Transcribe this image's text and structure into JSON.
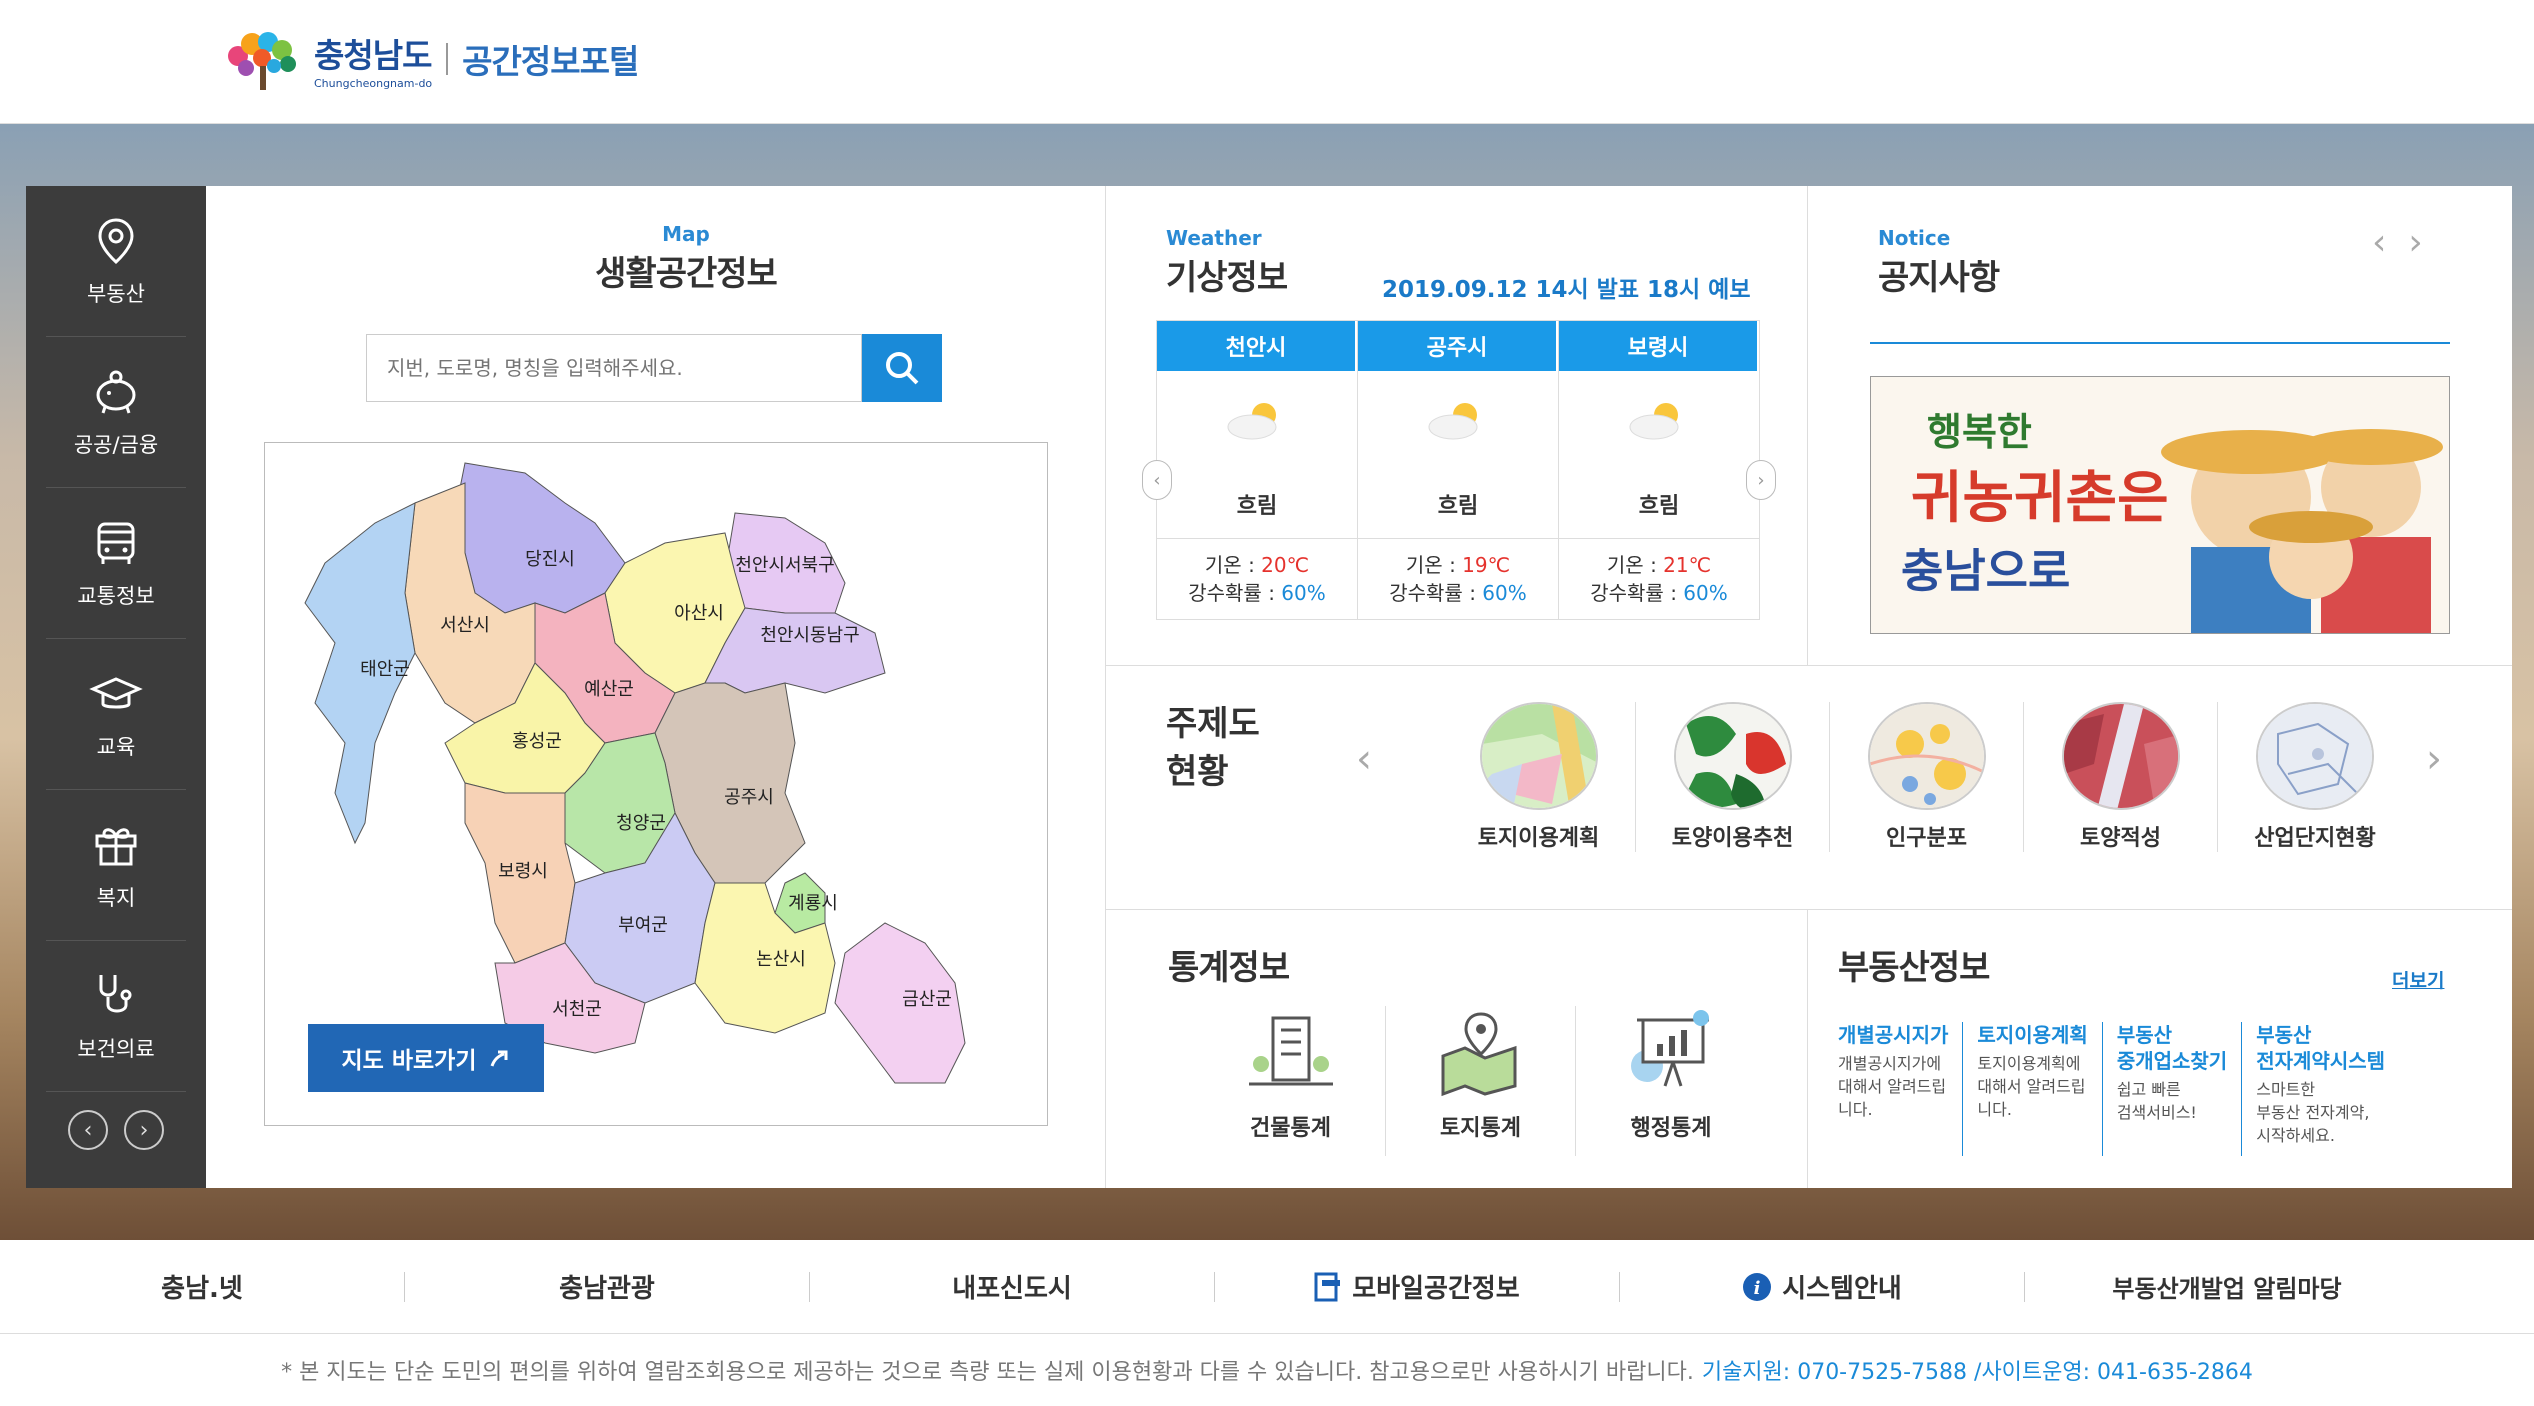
{
  "header": {
    "logo_main": "충청남도",
    "logo_sub": "Chungcheongnam-do",
    "portal_title": "공간정보포털"
  },
  "leftnav": {
    "items": [
      {
        "label": "부동산",
        "icon": "location-pin-icon"
      },
      {
        "label": "공공/금융",
        "icon": "piggy-bank-icon"
      },
      {
        "label": "교통정보",
        "icon": "bus-icon"
      },
      {
        "label": "교육",
        "icon": "graduation-cap-icon"
      },
      {
        "label": "복지",
        "icon": "gift-icon"
      },
      {
        "label": "보건의료",
        "icon": "stethoscope-icon"
      }
    ],
    "prev": "‹",
    "next": "›"
  },
  "map": {
    "en_label": "Map",
    "title": "생활공간정보",
    "search_placeholder": "지번, 도로명, 명칭을 입력해주세요.",
    "button": "지도 바로가기",
    "regions": [
      {
        "name": "당진시",
        "color": "#b9b2ee"
      },
      {
        "name": "천안시서북구",
        "color": "#e6c9f3"
      },
      {
        "name": "아산시",
        "color": "#fbf6b0"
      },
      {
        "name": "천안시동남구",
        "color": "#d9c7f2"
      },
      {
        "name": "서산시",
        "color": "#f7d9b8"
      },
      {
        "name": "태안군",
        "color": "#b3d3f3"
      },
      {
        "name": "예산군",
        "color": "#f4b3bf"
      },
      {
        "name": "홍성군",
        "color": "#f9f4a8"
      },
      {
        "name": "공주시",
        "color": "#d4c5b8"
      },
      {
        "name": "청양군",
        "color": "#b8e6a8"
      },
      {
        "name": "보령시",
        "color": "#f7d2b6"
      },
      {
        "name": "부여군",
        "color": "#cbcbf3"
      },
      {
        "name": "계룡시",
        "color": "#b8eaa2"
      },
      {
        "name": "논산시",
        "color": "#fbf6b0"
      },
      {
        "name": "서천군",
        "color": "#f5cbe6"
      },
      {
        "name": "금산군",
        "color": "#f3d0f1"
      }
    ]
  },
  "weather": {
    "en_label": "Weather",
    "title": "기상정보",
    "date": "2019.09.12 14시 발표 18시 예보",
    "cities": [
      {
        "city": "천안시",
        "condition": "흐림",
        "temp_label": "기온 : ",
        "temp": "20℃",
        "rain_label": "강수확률 : ",
        "rain": "60%"
      },
      {
        "city": "공주시",
        "condition": "흐림",
        "temp_label": "기온 : ",
        "temp": "19℃",
        "rain_label": "강수확률 : ",
        "rain": "60%"
      },
      {
        "city": "보령시",
        "condition": "흐림",
        "temp_label": "기온 : ",
        "temp": "21℃",
        "rain_label": "강수확률 : ",
        "rain": "60%"
      }
    ]
  },
  "notice": {
    "en_label": "Notice",
    "title": "공지사항",
    "banner_line1": "행복한",
    "banner_line2": "귀농귀촌은",
    "banner_line3": "충남으로"
  },
  "theme": {
    "title_line1": "주제도",
    "title_line2": "현황",
    "items": [
      {
        "label": "토지이용계획"
      },
      {
        "label": "토양이용추천"
      },
      {
        "label": "인구분포"
      },
      {
        "label": "토양적성"
      },
      {
        "label": "산업단지현황"
      }
    ]
  },
  "stats": {
    "title": "통계정보",
    "items": [
      {
        "label": "건물통계",
        "icon": "building-stats-icon"
      },
      {
        "label": "토지통계",
        "icon": "land-map-icon"
      },
      {
        "label": "행정통계",
        "icon": "presentation-chart-icon"
      }
    ]
  },
  "realestate": {
    "title": "부동산정보",
    "more": "더보기",
    "items": [
      {
        "name1": "개별공시지가",
        "name2": "",
        "desc": [
          "개별공시지가에",
          "대해서 알려드립",
          "니다."
        ]
      },
      {
        "name1": "토지이용계획",
        "name2": "",
        "desc": [
          "토지이용계획에",
          "대해서 알려드립",
          "니다."
        ]
      },
      {
        "name1": "부동산",
        "name2": "중개업소찾기",
        "desc": [
          "쉽고 빠른",
          "검색서비스!"
        ]
      },
      {
        "name1": "부동산",
        "name2": "전자계약시스템",
        "desc": [
          "스마트한",
          "부동산 전자계약,",
          "시작하세요."
        ]
      }
    ]
  },
  "footer": {
    "links": [
      "충남.넷",
      "충남관광",
      "내포신도시",
      "모바일공간정보",
      "시스템안내",
      "부동산개발업 알림마당"
    ],
    "note": "* 본 지도는 단순 도민의 편의를 위하여 열람조회용으로 제공하는 것으로 측량 또는 실제 이용현황과 다를 수 있습니다. 참고용으로만 사용하시기 바랍니다.",
    "contact": "기술지원: 070-7525-7588 /사이트운영: 041-635-2864"
  }
}
